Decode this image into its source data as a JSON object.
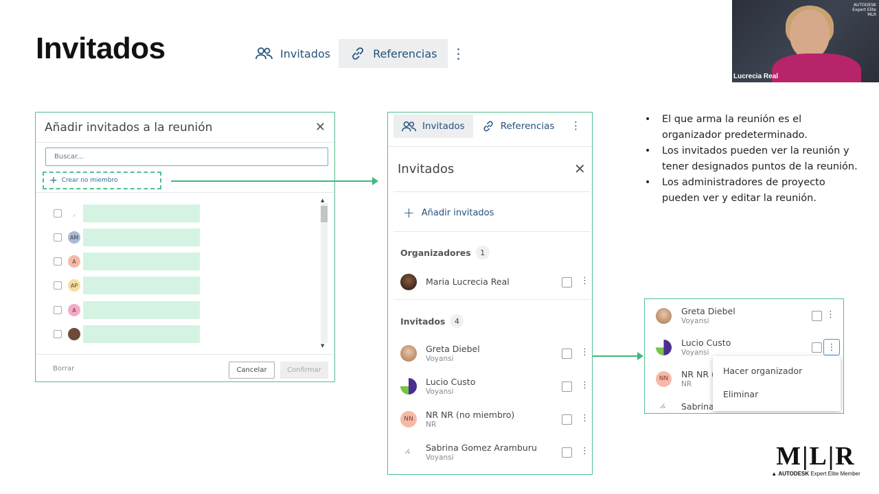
{
  "slide": {
    "title": "Invitados",
    "top_tabs": {
      "invitados": "Invitados",
      "referencias": "Referencias"
    },
    "bullets": [
      "El que arma la reunión es el organizador predeterminado.",
      "Los invitados pueden ver la reunión y tener designados puntos de la reunión.",
      "Los administradores de proyecto pueden ver y editar la reunión."
    ]
  },
  "video": {
    "speaker": "Lucrecia Real",
    "badge_line1": "AUTODESK",
    "badge_line2": "Expert Elite",
    "badge_line3": "MLR"
  },
  "dialog": {
    "title": "Añadir invitados a la reunión",
    "search_placeholder": "Buscar...",
    "create_label": "Crear no miembro",
    "rows": [
      {
        "initials": "",
        "color": "#fff7d9"
      },
      {
        "initials": "AM",
        "color": "#aab9d6"
      },
      {
        "initials": "A",
        "color": "#f7b9a7"
      },
      {
        "initials": "AP",
        "color": "#f8dea0"
      },
      {
        "initials": "A",
        "color": "#f5a9c8"
      },
      {
        "initials": "",
        "color": "#6b4a3a"
      }
    ],
    "clear_label": "Borrar",
    "cancel_label": "Cancelar",
    "confirm_label": "Confirmar"
  },
  "panel": {
    "tabs": {
      "invitados": "Invitados",
      "referencias": "Referencias"
    },
    "heading": "Invitados",
    "add_label": "Añadir invitados",
    "organizers_label": "Organizadores",
    "organizers_count": "1",
    "organizer": {
      "name": "Maria Lucrecia Real"
    },
    "guests_label": "Invitados",
    "guests_count": "4",
    "guests": [
      {
        "name": "Greta Diebel",
        "company": "Voyansi",
        "initials": ""
      },
      {
        "name": "Lucio Custo",
        "company": "Voyansi",
        "initials": ""
      },
      {
        "name": "NR NR (no miembro)",
        "company": "NR",
        "initials": "NN"
      },
      {
        "name": "Sabrina Gomez Aramburu",
        "company": "Voyansi",
        "initials": ""
      }
    ]
  },
  "popup": {
    "people": [
      {
        "name": "Greta Diebel",
        "company": "Voyansi"
      },
      {
        "name": "Lucio Custo",
        "company": "Voyansi"
      },
      {
        "name": "NR NR (",
        "company": "NR",
        "initials": "NN"
      },
      {
        "name": "Sabrina",
        "company": ""
      }
    ],
    "menu": {
      "make_organizer": "Hacer organizador",
      "remove": "Eliminar"
    }
  },
  "brand": {
    "logo": "M|L|R",
    "autodesk": "AUTODESK",
    "expert": "Expert Elite Member"
  },
  "colors": {
    "accent_green": "#4fc08d",
    "link_blue": "#26507a"
  }
}
